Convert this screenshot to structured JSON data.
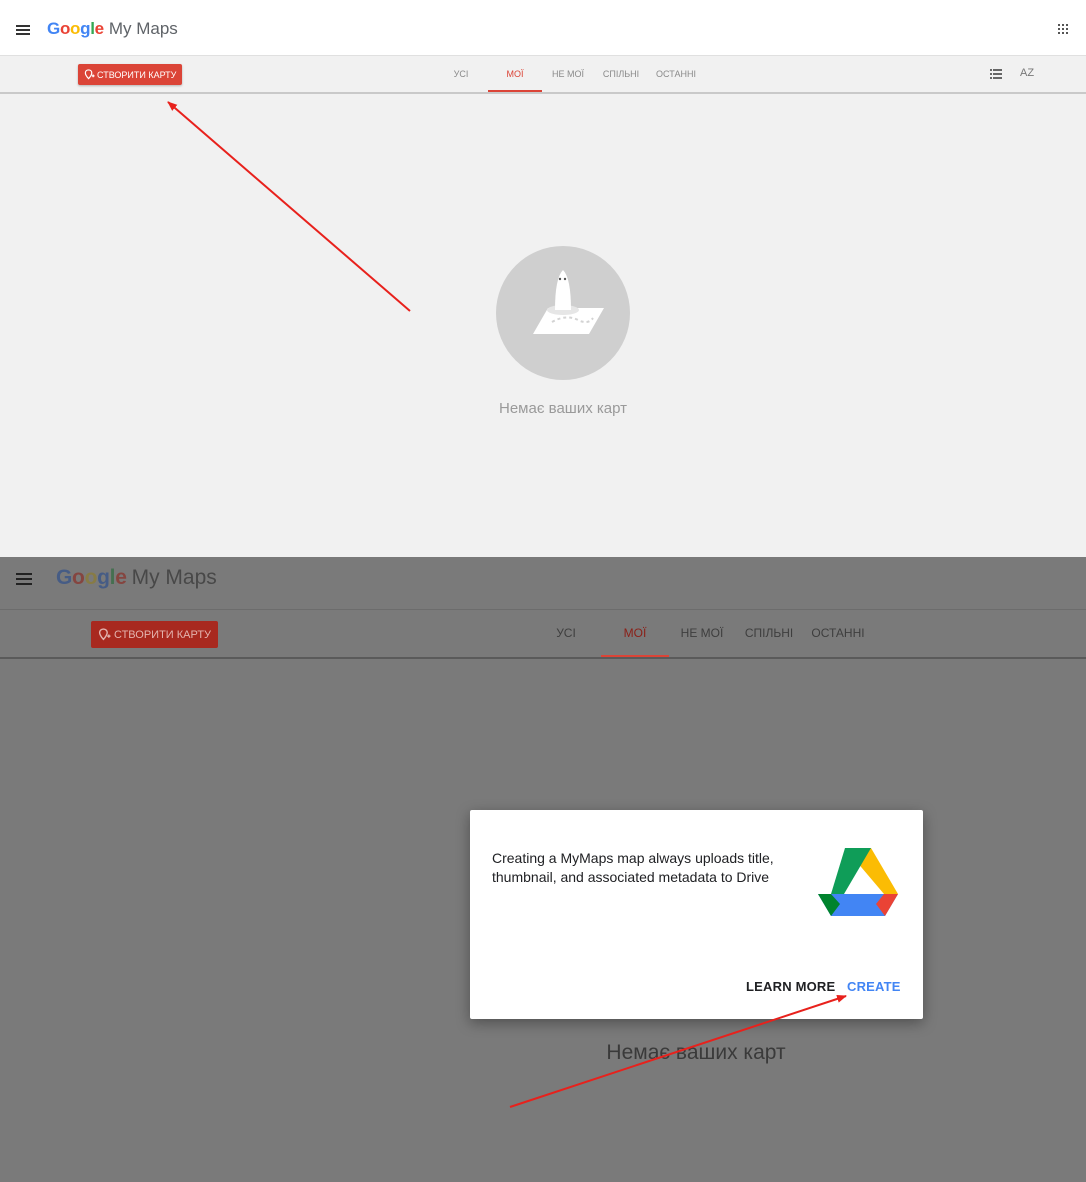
{
  "app": {
    "brand_google": "Google",
    "brand_product": "My Maps"
  },
  "toolbar": {
    "create_map_label": "СТВОРИТИ КАРТУ",
    "tabs": [
      {
        "label": "УСІ",
        "active": false
      },
      {
        "label": "МОЇ",
        "active": true
      },
      {
        "label": "НЕ МОЇ",
        "active": false
      },
      {
        "label": "СПІЛЬНІ",
        "active": false
      },
      {
        "label": "ОСТАННІ",
        "active": false
      }
    ],
    "sort_label": "AZ"
  },
  "empty_state": {
    "message": "Немає ваших карт"
  },
  "dialog": {
    "message": "Creating a MyMaps map always uploads title, thumbnail, and associated metadata to Drive",
    "learn_more_label": "LEARN MORE",
    "create_label": "CREATE"
  },
  "colors": {
    "accent_red": "#db4437",
    "link_blue": "#4285f4",
    "annotation_red": "#e8211c",
    "overlay_gray": "#7a7a7a"
  },
  "icons": [
    "menu-icon",
    "apps-grid-icon",
    "add-map-icon",
    "list-view-icon",
    "sort-az-icon",
    "empty-map-illustration",
    "google-drive-icon"
  ]
}
